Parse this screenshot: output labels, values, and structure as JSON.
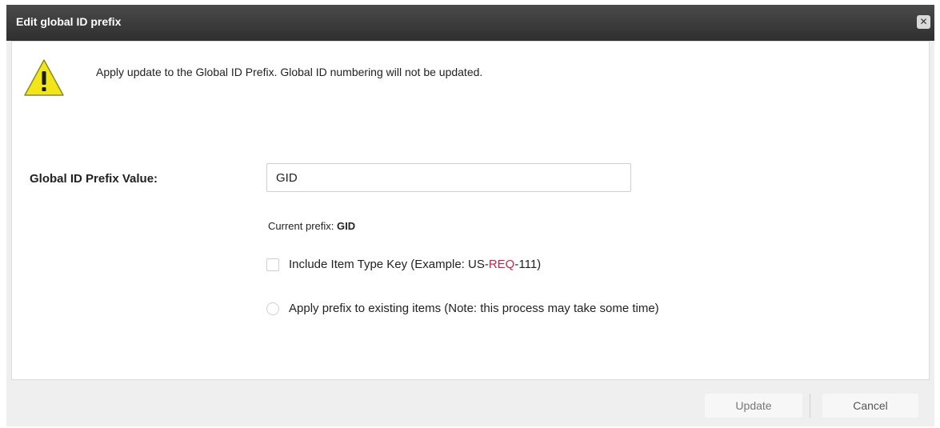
{
  "dialog": {
    "title": "Edit global ID prefix",
    "close_icon": "close-icon"
  },
  "warning": {
    "icon": "warning-icon",
    "message": "Apply update to the Global ID Prefix. Global ID numbering will not be updated."
  },
  "form": {
    "prefix_label": "Global ID Prefix Value:",
    "prefix_value": "GID",
    "current_prefix_label": "Current prefix:",
    "current_prefix_value": "GID",
    "include_item_type": {
      "label_before": "Include Item Type Key (Example: US-",
      "label_highlight": "REQ",
      "label_after": "-111)",
      "checked": false
    },
    "apply_existing": {
      "label": "Apply prefix to existing items (Note: this process may take some time)",
      "checked": false
    }
  },
  "footer": {
    "update_label": "Update",
    "cancel_label": "Cancel"
  },
  "colors": {
    "titlebar": "#3a3a3a",
    "highlight": "#cc1f4a",
    "warning_yellow": "#f2e61a"
  }
}
